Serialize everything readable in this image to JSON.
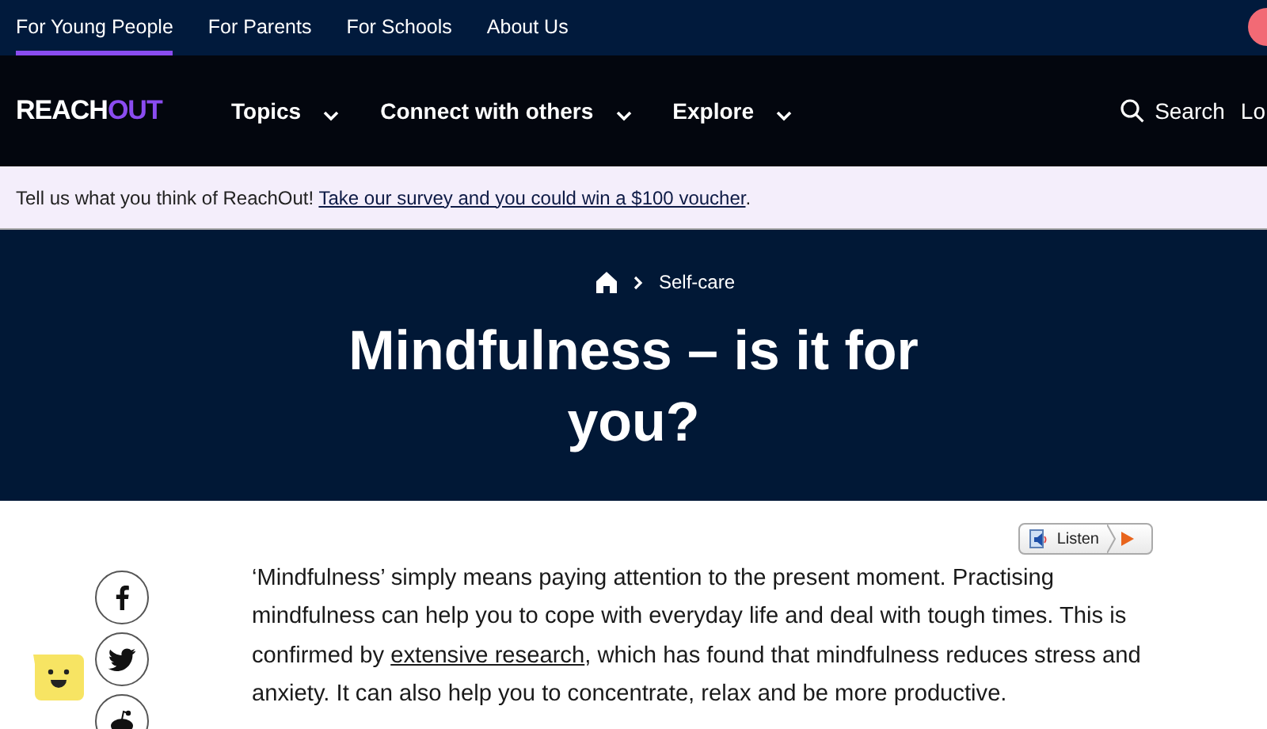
{
  "audience_tabs": [
    {
      "label": "For Young People",
      "selected": true
    },
    {
      "label": "For Parents",
      "selected": false
    },
    {
      "label": "For Schools",
      "selected": false
    },
    {
      "label": "About Us",
      "selected": false
    }
  ],
  "logo": {
    "first": "REACH",
    "second": "OUT"
  },
  "nav": {
    "items": [
      {
        "label": "Topics"
      },
      {
        "label": "Connect with others"
      },
      {
        "label": "Explore"
      }
    ],
    "search": "Search",
    "login": "Lo"
  },
  "banner": {
    "text": "Tell us what you think of ReachOut!",
    "link": "Take our survey and you could win a $100 voucher",
    "after": "."
  },
  "breadcrumb": {
    "current": "Self-care"
  },
  "title": "Mindfulness – is it for you?",
  "listen": {
    "label": "Listen"
  },
  "share": [
    {
      "kind": "facebook"
    },
    {
      "kind": "twitter"
    },
    {
      "kind": "reddit"
    }
  ],
  "article": {
    "before": "‘Mindfulness’ simply means paying attention to the present moment. Practising mindfulness can help you to cope with everyday life and deal with tough times. This is confirmed by",
    "link": "extensive research",
    "after": ", which has found that mindfulness reduces stress and anxiety. It can also help you to concentrate, relax and be more productive."
  }
}
